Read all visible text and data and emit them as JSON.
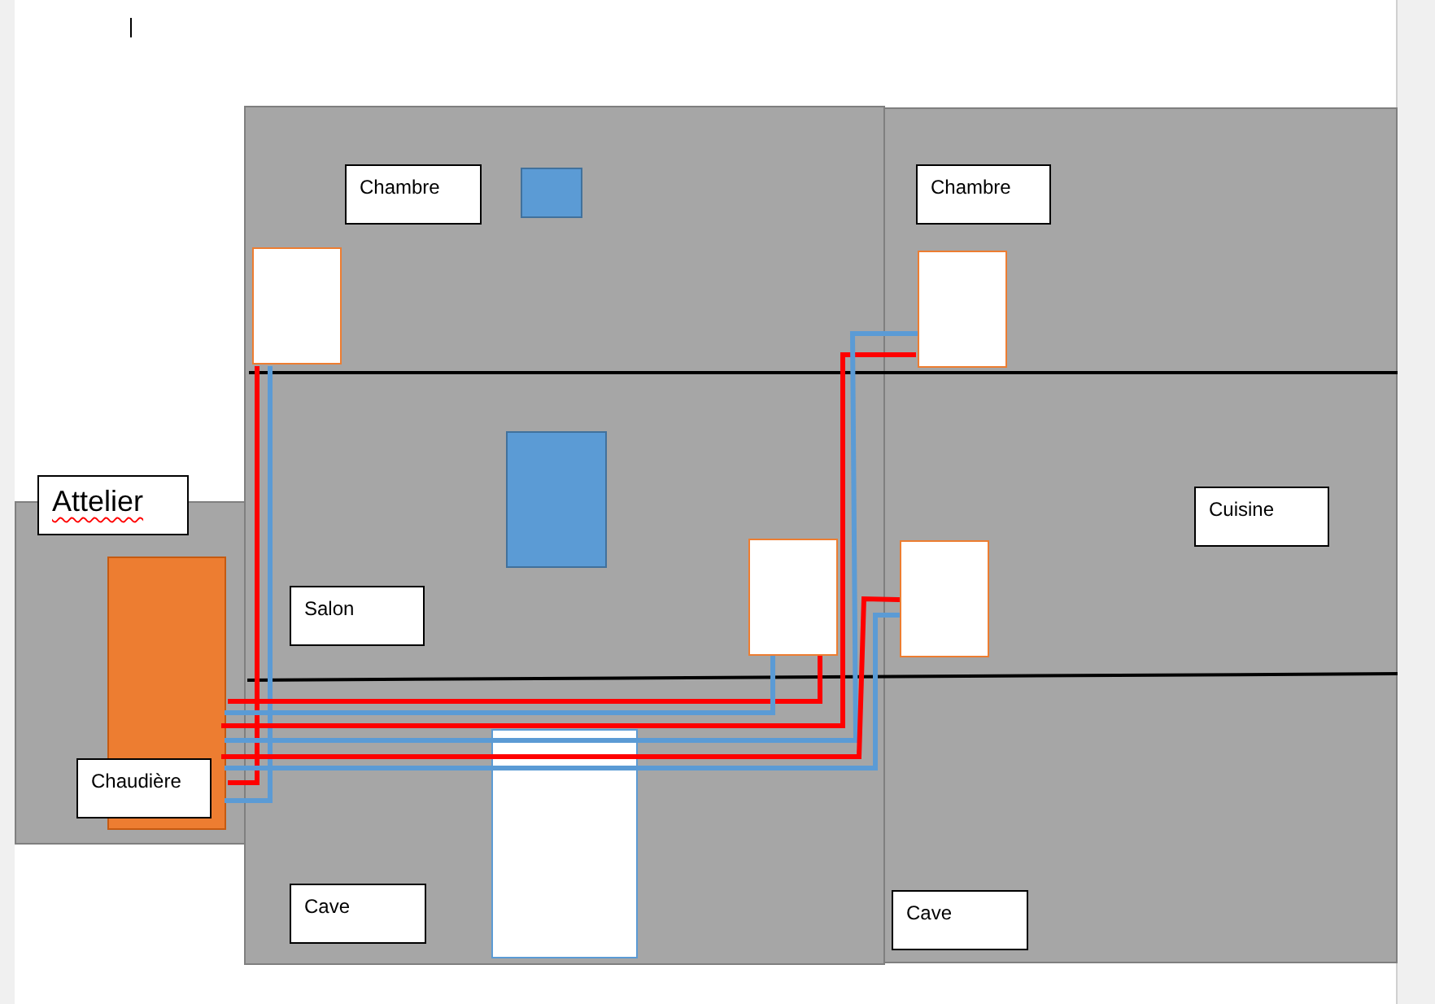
{
  "labels": [
    {
      "text": "Chambre",
      "misspelled": false
    },
    {
      "text": "Chambre",
      "misspelled": false
    },
    {
      "text": "Attelier",
      "misspelled": true
    },
    {
      "text": "Cuisine",
      "misspelled": false
    },
    {
      "text": "Salon",
      "misspelled": false
    },
    {
      "text": "Chaudière",
      "misspelled": false
    },
    {
      "text": "Cave",
      "misspelled": false
    },
    {
      "text": "Cave",
      "misspelled": false
    }
  ]
}
